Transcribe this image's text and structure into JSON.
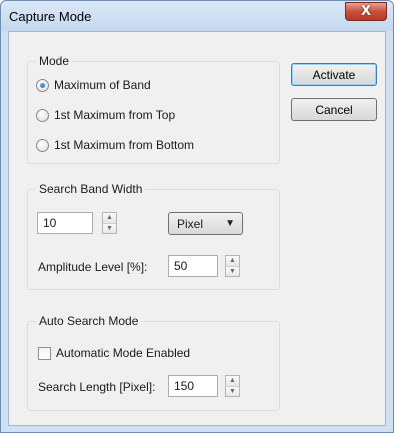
{
  "window": {
    "title": "Capture Mode",
    "close_glyph": "X"
  },
  "buttons": {
    "activate": "Activate",
    "cancel": "Cancel"
  },
  "mode_group": {
    "title": "Mode",
    "options": [
      {
        "label": "Maximum of Band",
        "checked": true
      },
      {
        "label": "1st Maximum from Top",
        "checked": false
      },
      {
        "label": "1st Maximum from Bottom",
        "checked": false
      }
    ]
  },
  "search_band_group": {
    "title": "Search Band Width",
    "width_value": "10",
    "unit_selected": "Pixel",
    "amplitude_label": "Amplitude Level [%]:",
    "amplitude_value": "50"
  },
  "auto_search_group": {
    "title": "Auto Search Mode",
    "checkbox_label": "Automatic Mode Enabled",
    "checkbox_checked": false,
    "length_label": "Search Length [Pixel]:",
    "length_value": "150"
  },
  "icons": {
    "spin_up": "▲",
    "spin_down": "▼",
    "dropdown": "▼"
  }
}
